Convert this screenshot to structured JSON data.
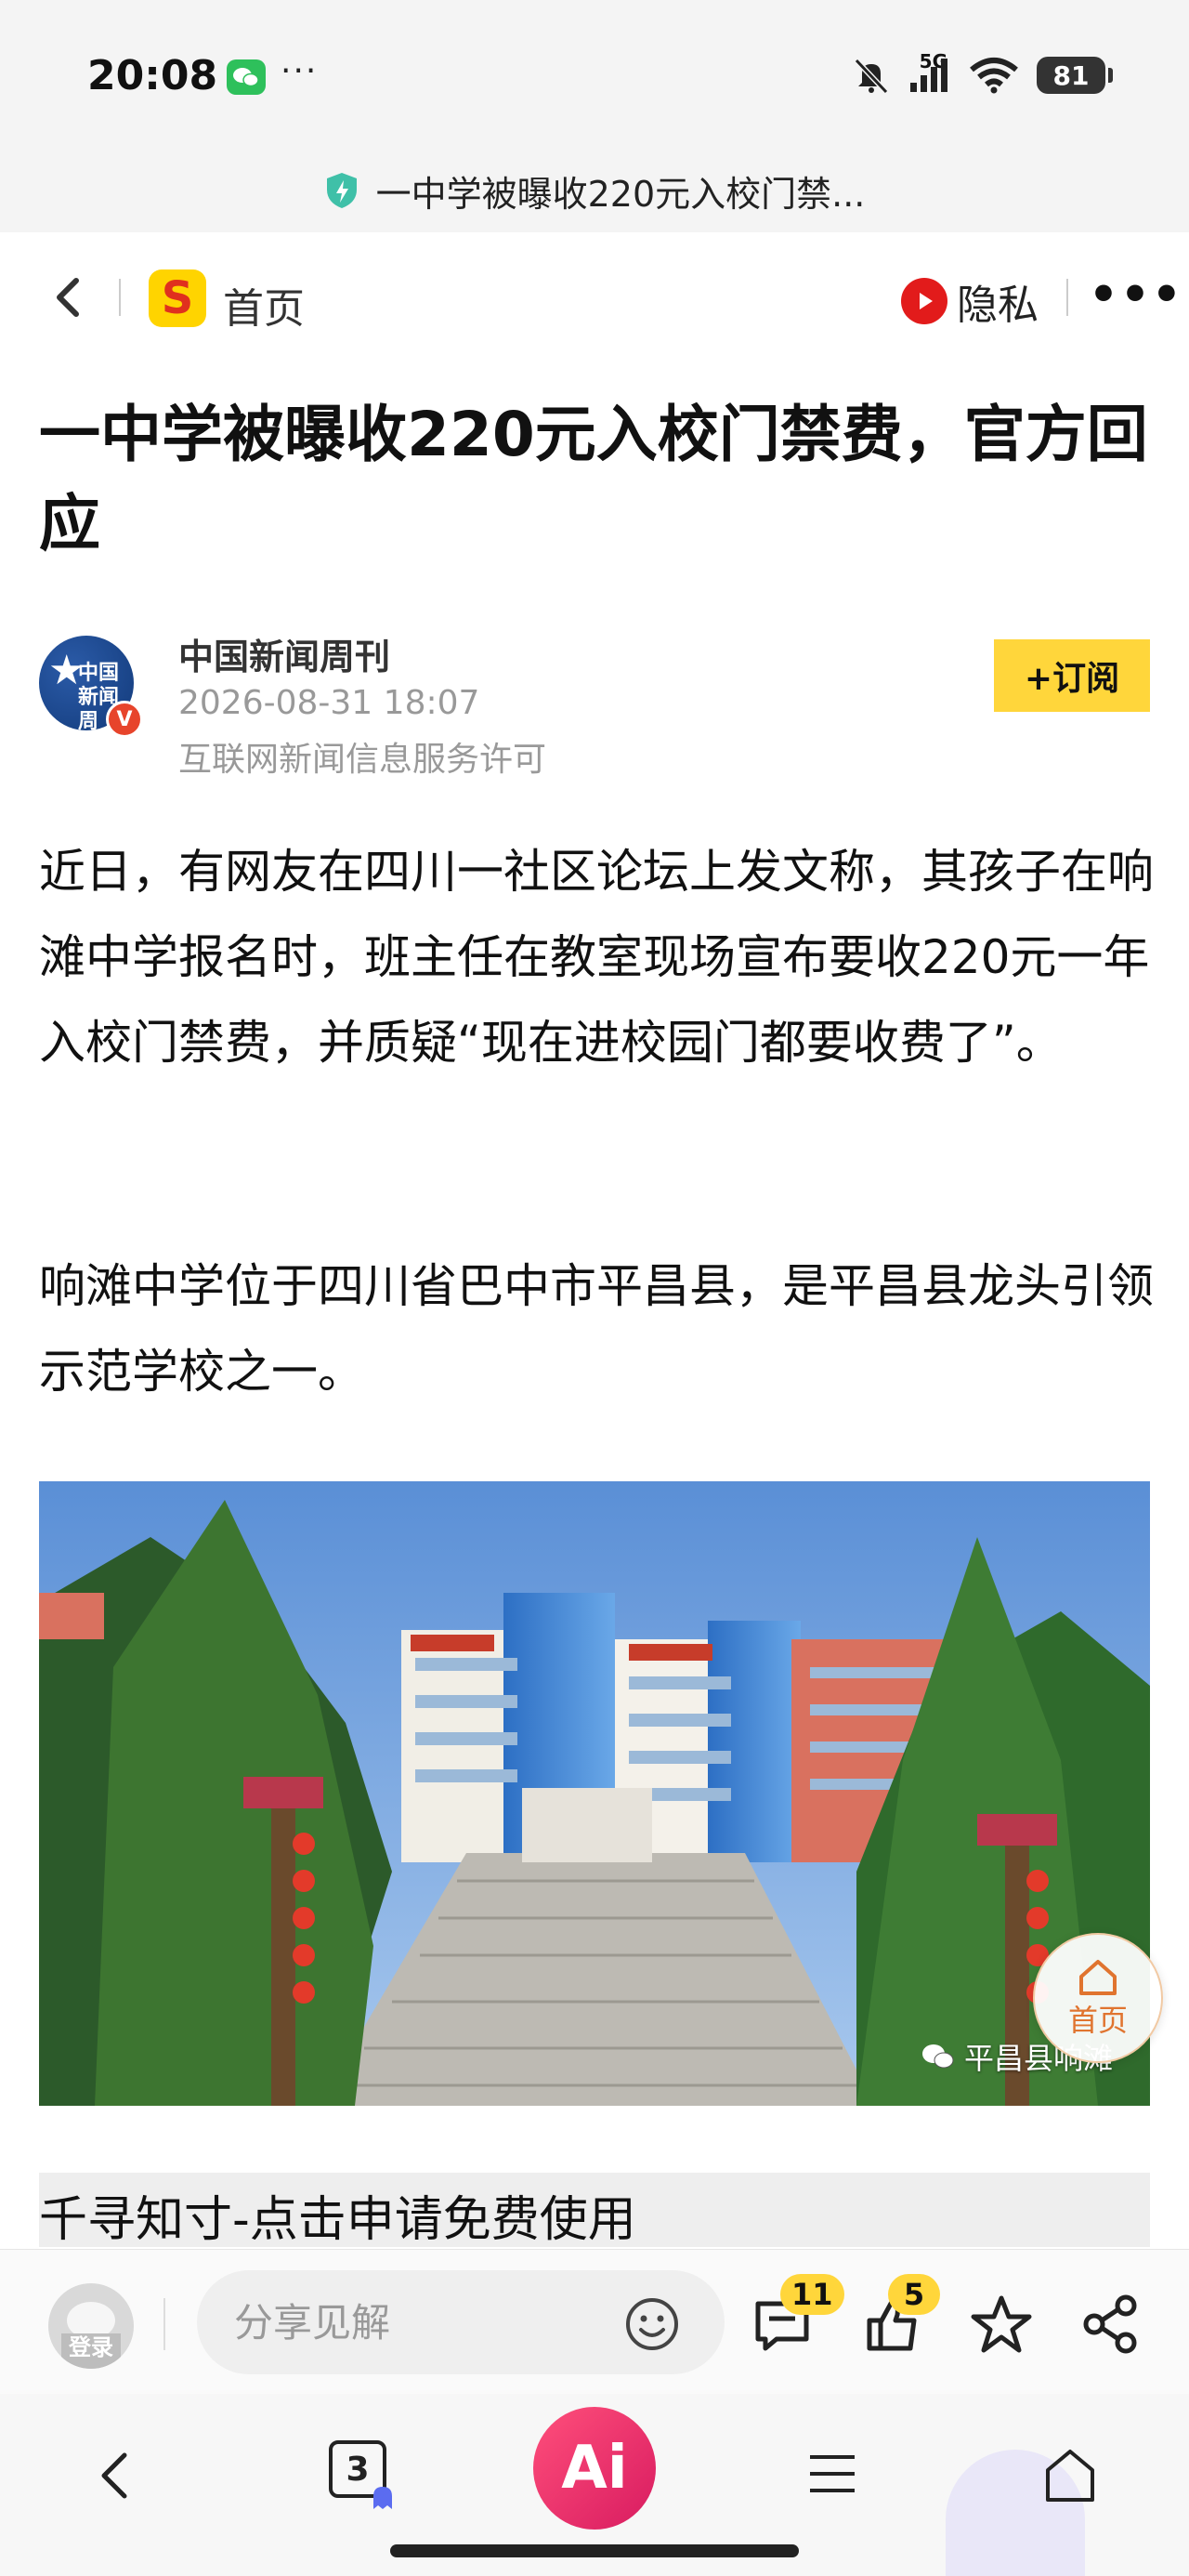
{
  "status_bar": {
    "time": "20:08",
    "more": "···",
    "network": "5G",
    "battery": "81"
  },
  "tab": {
    "title": "一中学被曝收220元入校门禁..."
  },
  "nav": {
    "logo_letter": "S",
    "home_label": "首页",
    "privacy_label": "隐私",
    "more_label": "•••"
  },
  "article": {
    "title": "一中学被曝收220元入校门禁费，官方回应",
    "author": {
      "name": "中国新闻周刊",
      "avatar_text": "中国 新闻周",
      "datetime": "2026-08-31 18:07",
      "license": "互联网新闻信息服务许可",
      "subscribe_label": "+订阅"
    },
    "paragraphs": [
      "近日，有网友在四川一社区论坛上发文称，其孩子在响滩中学报名时，班主任在教室现场宣布要收220元一年入校门禁费，并质疑“现在进校园门都要收费了”。",
      "响滩中学位于四川省巴中市平昌县，是平昌县龙头引领示范学校之一。"
    ],
    "image_watermark": "平昌县响滩",
    "ad_text": "千寻知寸-点击申请免费使用"
  },
  "floating_home": {
    "label": "首页"
  },
  "comment_bar": {
    "login_label": "登录",
    "input_placeholder": "分享见解",
    "comment_count": "11",
    "like_count": "5"
  },
  "system_nav": {
    "tabs_count": "3",
    "ai_label": "Ai"
  },
  "colors": {
    "accent_yellow": "#ffd63b",
    "privacy_red": "#e21b1b",
    "ai_pink": "#e8336b",
    "home_orange": "#e0742f"
  }
}
